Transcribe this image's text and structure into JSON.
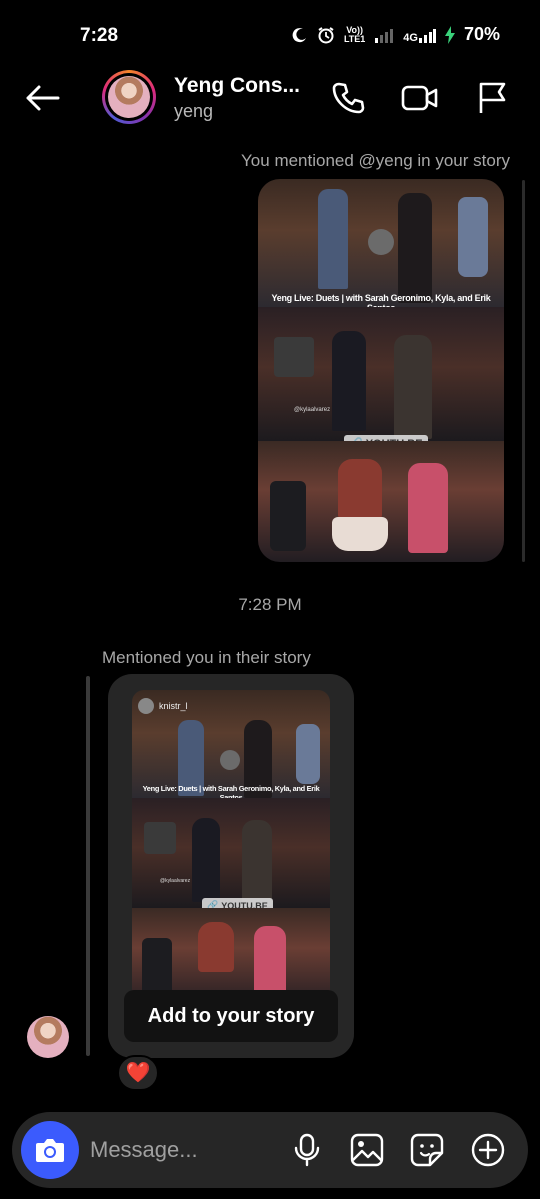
{
  "status_bar": {
    "time": "7:28",
    "network_top": "Vo))",
    "network_bottom": "LTE1",
    "network_type": "4G",
    "battery": "70%"
  },
  "header": {
    "contact_name": "Yeng Cons...",
    "contact_handle": "yeng",
    "icons": [
      "back-arrow-icon",
      "phone-icon",
      "video-camera-icon",
      "flag-icon"
    ]
  },
  "thread": {
    "sent_meta": "You mentioned @yeng in your story",
    "story_title": "Yeng Live: Duets | with Sarah Geronimo, Kyla, and Erik Santos",
    "story_link": "YOUTU.BE",
    "story_mention": "@kylaalvarez",
    "timestamp": "7:28 PM",
    "received_meta": "Mentioned you in their story",
    "received_story_user": "knistr_l",
    "add_to_story": "Add to your story",
    "reaction": "❤️"
  },
  "composer": {
    "placeholder": "Message...",
    "accent": "#3b5bfd"
  }
}
